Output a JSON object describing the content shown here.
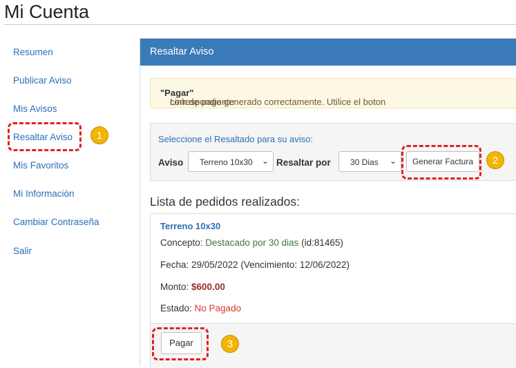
{
  "page": {
    "title": "Mi Cuenta"
  },
  "sidebar": {
    "items": [
      {
        "label": "Resumen"
      },
      {
        "label": "Publicar Aviso"
      },
      {
        "label": "Mis Avisos"
      },
      {
        "label": "Resaltar Aviso"
      },
      {
        "label": "Mis Favoritos"
      },
      {
        "label": "Mi Información"
      },
      {
        "label": "Cambiar Contraseña"
      },
      {
        "label": "Salir"
      }
    ]
  },
  "panel": {
    "title": "Resaltar Aviso",
    "alert": {
      "text_before": "Link de pago generado correctamente. Utilice el boton ",
      "bold": "\"Pagar\"",
      "text_after": " correspondiente"
    },
    "form": {
      "instruction": "Seleccione el Resaltado para su aviso:",
      "aviso_label": "Aviso",
      "aviso_value": "Terreno 10x30",
      "resaltar_label": "Resaltar por",
      "resaltar_value": "30 Dias",
      "generate_button": "Generar Factura"
    },
    "orders": {
      "title": "Lista de pedidos realizados:",
      "item": {
        "name": "Terreno 10x30",
        "concepto_label": "Concepto: ",
        "concepto_value": "Destacado por 30 dias",
        "concepto_id": " (id:81465)",
        "fecha": "Fecha: 29/05/2022 (Vencimiento: 12/06/2022)",
        "monto_label": "Monto: ",
        "monto_value": "$600.00",
        "estado_label": "Estado: ",
        "estado_value": "No Pagado",
        "pay_button": "Pagar"
      }
    }
  },
  "annotations": {
    "badge1": "1",
    "badge2": "2",
    "badge3": "3"
  },
  "colors": {
    "header": "#3a7ab8",
    "annotation": "#e02020",
    "badge": "#f4b400"
  }
}
